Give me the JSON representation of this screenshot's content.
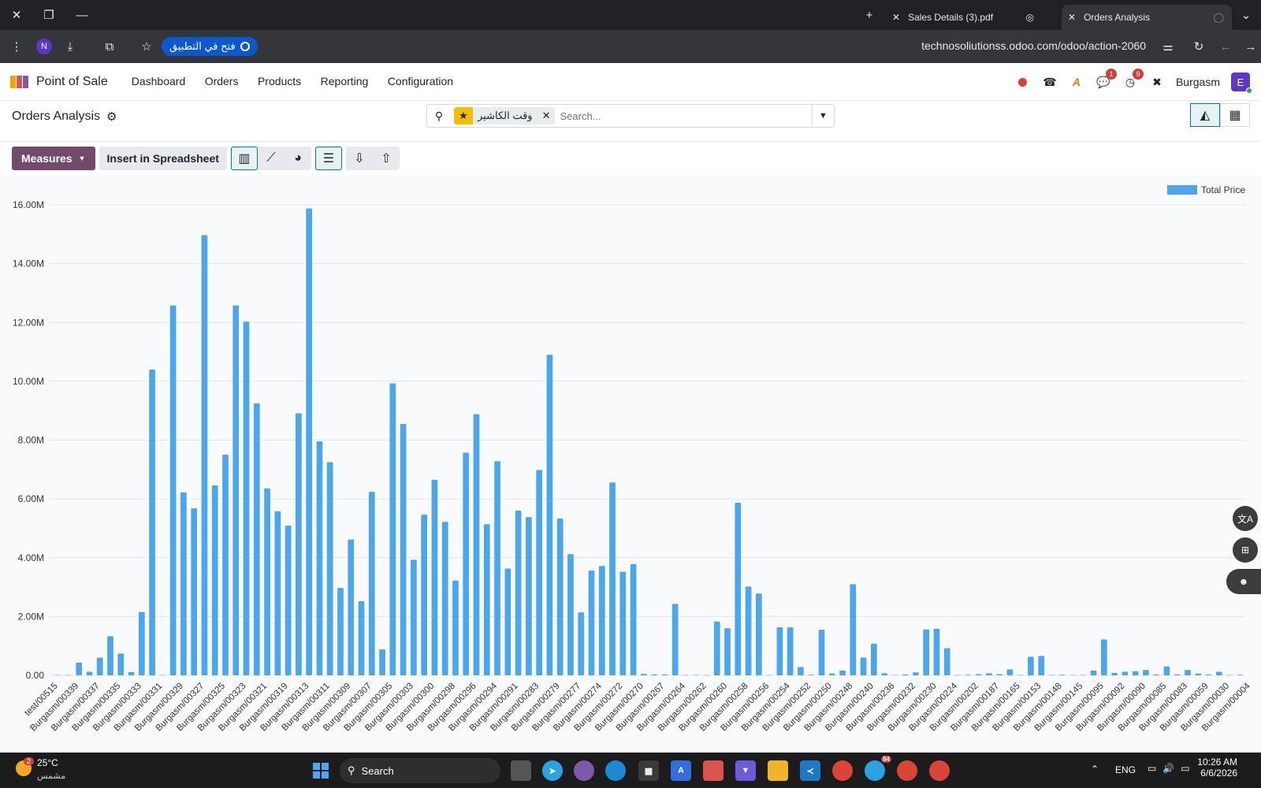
{
  "browser": {
    "tabs": [
      {
        "label": "Sales Details (3).pdf"
      },
      {
        "label": "Orders Analysis"
      }
    ],
    "open_in_app_label": "فتح في التطبيق",
    "profile_letter": "N",
    "url": "technosoliutionss.odoo.com/odoo/action-2060"
  },
  "app": {
    "name": "Point of Sale",
    "menu": [
      "Dashboard",
      "Orders",
      "Products",
      "Reporting",
      "Configuration"
    ],
    "chat_badge": "1",
    "activity_badge": "9",
    "company": "Burgasm",
    "user_initial": "E"
  },
  "control": {
    "title": "Orders Analysis",
    "facet_label": "وقت الكاشير",
    "search_placeholder": "Search...",
    "measures_label": "Measures",
    "insert_label": "Insert in Spreadsheet"
  },
  "chart_data": {
    "type": "bar",
    "legend": "Total Price",
    "legend_position": "top-right",
    "ylim": [
      0,
      16000000
    ],
    "yticks": [
      "0.00",
      "2.00M",
      "4.00M",
      "6.00M",
      "8.00M",
      "10.00M",
      "12.00M",
      "14.00M",
      "16.00M"
    ],
    "tick_labels": [
      "test/00515",
      "Burgasm/00339",
      "Burgasm/00337",
      "Burgasm/00335",
      "Burgasm/00333",
      "Burgasm/00331",
      "Burgasm/00329",
      "Burgasm/00327",
      "Burgasm/00325",
      "Burgasm/00323",
      "Burgasm/00321",
      "Burgasm/00319",
      "Burgasm/00313",
      "Burgasm/00311",
      "Burgasm/00309",
      "Burgasm/00307",
      "Burgasm/00305",
      "Burgasm/00303",
      "Burgasm/00300",
      "Burgasm/00298",
      "Burgasm/00296",
      "Burgasm/00294",
      "Burgasm/00291",
      "Burgasm/00283",
      "Burgasm/00279",
      "Burgasm/00277",
      "Burgasm/00274",
      "Burgasm/00272",
      "Burgasm/00270",
      "Burgasm/00267",
      "Burgasm/00264",
      "Burgasm/00262",
      "Burgasm/00260",
      "Burgasm/00258",
      "Burgasm/00256",
      "Burgasm/00254",
      "Burgasm/00252",
      "Burgasm/00250",
      "Burgasm/00248",
      "Burgasm/00240",
      "Burgasm/00236",
      "Burgasm/00232",
      "Burgasm/00230",
      "Burgasm/00224",
      "Burgasm/00202",
      "Burgasm/00187",
      "Burgasm/00165",
      "Burgasm/00153",
      "Burgasm/00148",
      "Burgasm/00145",
      "Burgasm/00095",
      "Burgasm/00092",
      "Burgasm/00090",
      "Burgasm/00085",
      "Burgasm/00083",
      "Burgasm/00059",
      "Burgasm/00030",
      "Burgasm/00004"
    ],
    "values": [
      0.01,
      0.01,
      0.43,
      0.12,
      0.6,
      1.33,
      0.74,
      0.11,
      2.15,
      10.4,
      0.01,
      12.58,
      6.22,
      5.68,
      14.97,
      6.46,
      7.5,
      12.58,
      12.03,
      9.25,
      6.36,
      5.58,
      5.09,
      8.91,
      15.88,
      7.96,
      7.25,
      2.97,
      4.62,
      2.52,
      6.24,
      0.88,
      9.93,
      8.55,
      3.93,
      5.46,
      6.65,
      5.22,
      3.22,
      7.57,
      8.88,
      5.14,
      7.28,
      3.63,
      5.6,
      5.38,
      6.98,
      10.9,
      5.33,
      4.12,
      2.14,
      3.56,
      3.72,
      6.56,
      3.52,
      3.78,
      0.05,
      0.03,
      0.03,
      2.43,
      0.01,
      0.01,
      0.01,
      1.83,
      1.6,
      5.87,
      3.02,
      2.78,
      0.01,
      1.63,
      1.63,
      0.28,
      0.02,
      1.55,
      0.06,
      0.16,
      3.1,
      0.6,
      1.08,
      0.07,
      0.01,
      0.03,
      0.1,
      1.56,
      1.58,
      0.92,
      0.01,
      0.02,
      0.04,
      0.07,
      0.04,
      0.2,
      0.01,
      0.63,
      0.66,
      0.01,
      0.02,
      0.01,
      0.01,
      0.16,
      1.22,
      0.08,
      0.12,
      0.14,
      0.18,
      0.03,
      0.3,
      0.03,
      0.18,
      0.06,
      0.03,
      0.12,
      0.01,
      0.02
    ]
  },
  "taskbar": {
    "weather_badge": "2",
    "temperature": "25°C",
    "weather_text": "مشمس",
    "search_label": "Search",
    "telegram_badge": "84",
    "language": "ENG",
    "time": "10:26 AM",
    "date": "6/6/2026"
  },
  "colors": {
    "bar": "#4ba6ec",
    "brand": "#714b67",
    "accent": "#017e84"
  }
}
